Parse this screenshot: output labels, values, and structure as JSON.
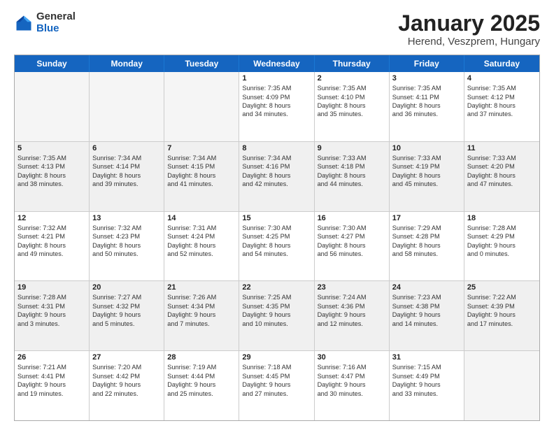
{
  "logo": {
    "general": "General",
    "blue": "Blue"
  },
  "title": "January 2025",
  "subtitle": "Herend, Veszprem, Hungary",
  "days": [
    "Sunday",
    "Monday",
    "Tuesday",
    "Wednesday",
    "Thursday",
    "Friday",
    "Saturday"
  ],
  "weeks": [
    [
      {
        "day": "",
        "info": ""
      },
      {
        "day": "",
        "info": ""
      },
      {
        "day": "",
        "info": ""
      },
      {
        "day": "1",
        "info": "Sunrise: 7:35 AM\nSunset: 4:09 PM\nDaylight: 8 hours\nand 34 minutes."
      },
      {
        "day": "2",
        "info": "Sunrise: 7:35 AM\nSunset: 4:10 PM\nDaylight: 8 hours\nand 35 minutes."
      },
      {
        "day": "3",
        "info": "Sunrise: 7:35 AM\nSunset: 4:11 PM\nDaylight: 8 hours\nand 36 minutes."
      },
      {
        "day": "4",
        "info": "Sunrise: 7:35 AM\nSunset: 4:12 PM\nDaylight: 8 hours\nand 37 minutes."
      }
    ],
    [
      {
        "day": "5",
        "info": "Sunrise: 7:35 AM\nSunset: 4:13 PM\nDaylight: 8 hours\nand 38 minutes."
      },
      {
        "day": "6",
        "info": "Sunrise: 7:34 AM\nSunset: 4:14 PM\nDaylight: 8 hours\nand 39 minutes."
      },
      {
        "day": "7",
        "info": "Sunrise: 7:34 AM\nSunset: 4:15 PM\nDaylight: 8 hours\nand 41 minutes."
      },
      {
        "day": "8",
        "info": "Sunrise: 7:34 AM\nSunset: 4:16 PM\nDaylight: 8 hours\nand 42 minutes."
      },
      {
        "day": "9",
        "info": "Sunrise: 7:33 AM\nSunset: 4:18 PM\nDaylight: 8 hours\nand 44 minutes."
      },
      {
        "day": "10",
        "info": "Sunrise: 7:33 AM\nSunset: 4:19 PM\nDaylight: 8 hours\nand 45 minutes."
      },
      {
        "day": "11",
        "info": "Sunrise: 7:33 AM\nSunset: 4:20 PM\nDaylight: 8 hours\nand 47 minutes."
      }
    ],
    [
      {
        "day": "12",
        "info": "Sunrise: 7:32 AM\nSunset: 4:21 PM\nDaylight: 8 hours\nand 49 minutes."
      },
      {
        "day": "13",
        "info": "Sunrise: 7:32 AM\nSunset: 4:23 PM\nDaylight: 8 hours\nand 50 minutes."
      },
      {
        "day": "14",
        "info": "Sunrise: 7:31 AM\nSunset: 4:24 PM\nDaylight: 8 hours\nand 52 minutes."
      },
      {
        "day": "15",
        "info": "Sunrise: 7:30 AM\nSunset: 4:25 PM\nDaylight: 8 hours\nand 54 minutes."
      },
      {
        "day": "16",
        "info": "Sunrise: 7:30 AM\nSunset: 4:27 PM\nDaylight: 8 hours\nand 56 minutes."
      },
      {
        "day": "17",
        "info": "Sunrise: 7:29 AM\nSunset: 4:28 PM\nDaylight: 8 hours\nand 58 minutes."
      },
      {
        "day": "18",
        "info": "Sunrise: 7:28 AM\nSunset: 4:29 PM\nDaylight: 9 hours\nand 0 minutes."
      }
    ],
    [
      {
        "day": "19",
        "info": "Sunrise: 7:28 AM\nSunset: 4:31 PM\nDaylight: 9 hours\nand 3 minutes."
      },
      {
        "day": "20",
        "info": "Sunrise: 7:27 AM\nSunset: 4:32 PM\nDaylight: 9 hours\nand 5 minutes."
      },
      {
        "day": "21",
        "info": "Sunrise: 7:26 AM\nSunset: 4:34 PM\nDaylight: 9 hours\nand 7 minutes."
      },
      {
        "day": "22",
        "info": "Sunrise: 7:25 AM\nSunset: 4:35 PM\nDaylight: 9 hours\nand 10 minutes."
      },
      {
        "day": "23",
        "info": "Sunrise: 7:24 AM\nSunset: 4:36 PM\nDaylight: 9 hours\nand 12 minutes."
      },
      {
        "day": "24",
        "info": "Sunrise: 7:23 AM\nSunset: 4:38 PM\nDaylight: 9 hours\nand 14 minutes."
      },
      {
        "day": "25",
        "info": "Sunrise: 7:22 AM\nSunset: 4:39 PM\nDaylight: 9 hours\nand 17 minutes."
      }
    ],
    [
      {
        "day": "26",
        "info": "Sunrise: 7:21 AM\nSunset: 4:41 PM\nDaylight: 9 hours\nand 19 minutes."
      },
      {
        "day": "27",
        "info": "Sunrise: 7:20 AM\nSunset: 4:42 PM\nDaylight: 9 hours\nand 22 minutes."
      },
      {
        "day": "28",
        "info": "Sunrise: 7:19 AM\nSunset: 4:44 PM\nDaylight: 9 hours\nand 25 minutes."
      },
      {
        "day": "29",
        "info": "Sunrise: 7:18 AM\nSunset: 4:45 PM\nDaylight: 9 hours\nand 27 minutes."
      },
      {
        "day": "30",
        "info": "Sunrise: 7:16 AM\nSunset: 4:47 PM\nDaylight: 9 hours\nand 30 minutes."
      },
      {
        "day": "31",
        "info": "Sunrise: 7:15 AM\nSunset: 4:49 PM\nDaylight: 9 hours\nand 33 minutes."
      },
      {
        "day": "",
        "info": ""
      }
    ]
  ]
}
